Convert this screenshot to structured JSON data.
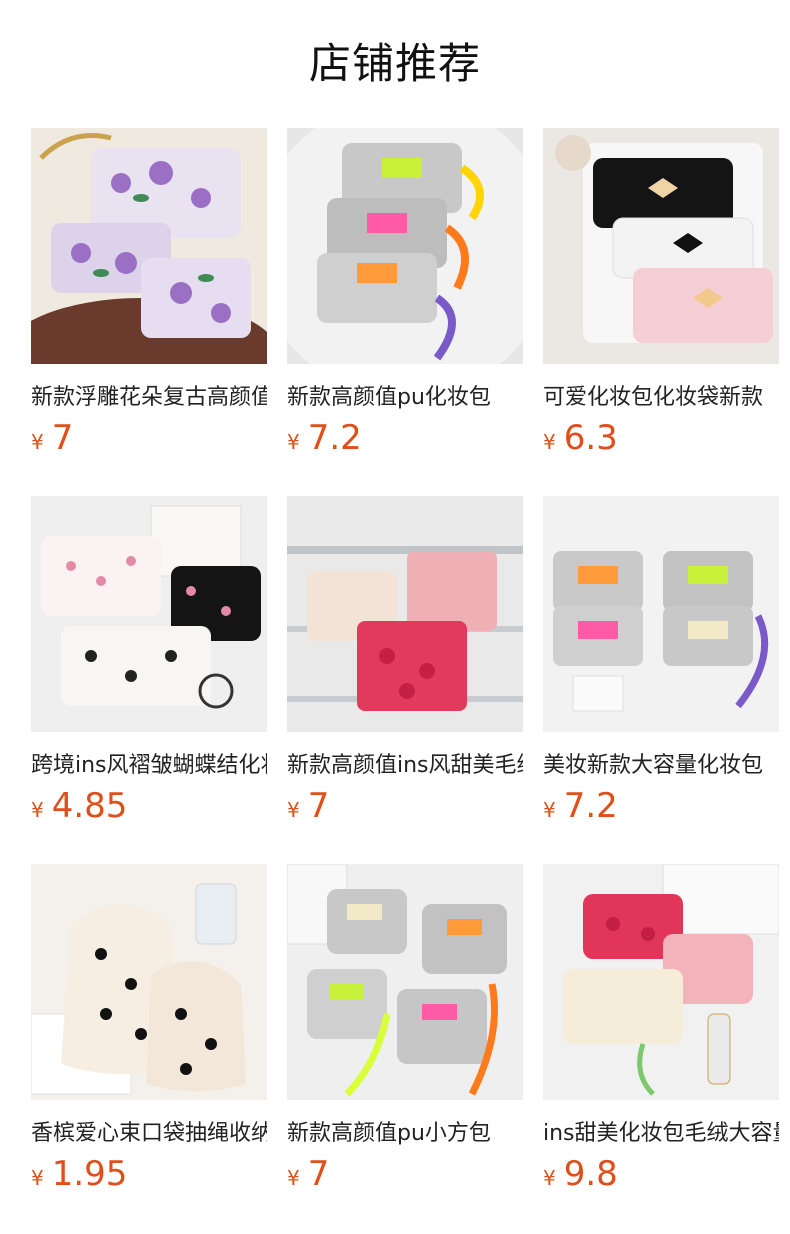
{
  "section": {
    "title": "店铺推荐"
  },
  "currency_symbol": "¥",
  "products": [
    {
      "name": "新款浮雕花朵复古高颜值化妆包",
      "price": "7"
    },
    {
      "name": "新款高颜值pu化妆包",
      "price": "7.2"
    },
    {
      "name": "可爱化妆包化妆袋新款",
      "price": "6.3"
    },
    {
      "name": "跨境ins风褶皱蝴蝶结化妆包",
      "price": "4.85"
    },
    {
      "name": "新款高颜值ins风甜美毛绒化妆包",
      "price": "7"
    },
    {
      "name": "美妆新款大容量化妆包",
      "price": "7.2"
    },
    {
      "name": "香槟爱心束口袋抽绳收纳袋",
      "price": "1.95"
    },
    {
      "name": "新款高颜值pu小方包",
      "price": "7"
    },
    {
      "name": "ins甜美化妆包毛绒大容量",
      "price": "9.8"
    }
  ],
  "colors": {
    "price": "#e04e1a",
    "title": "#111111",
    "text": "#222222"
  },
  "icons": [
    "product-image"
  ]
}
